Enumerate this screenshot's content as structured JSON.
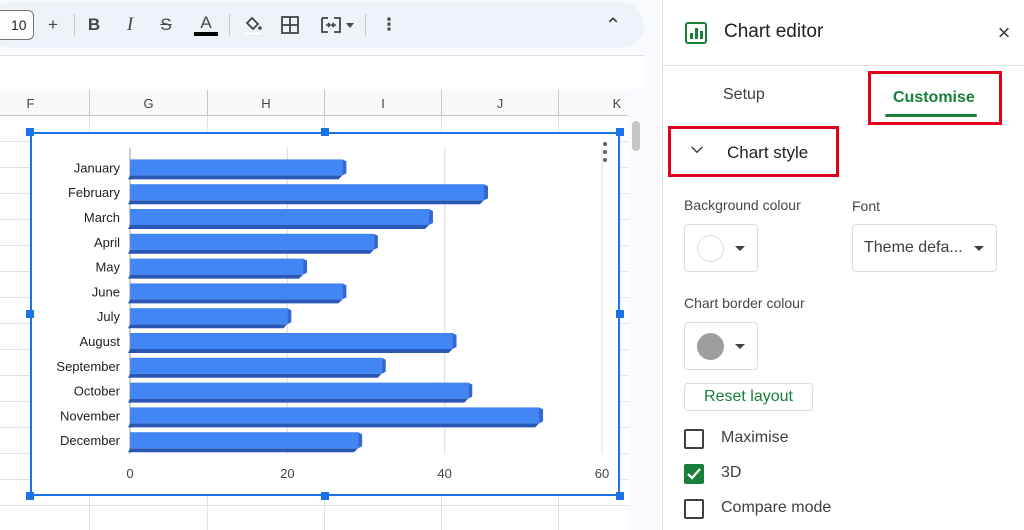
{
  "toolbar": {
    "font_size": "10",
    "plus_label": "+",
    "bold_label": "B",
    "italic_label": "I",
    "strike_label": "S",
    "text_color_label": "A",
    "more_label": "⋮",
    "collapse_label": "⌃"
  },
  "sheet": {
    "columns": [
      "F",
      "G",
      "H",
      "I",
      "J",
      "K"
    ]
  },
  "chart_data": {
    "type": "bar",
    "orientation": "horizontal",
    "three_d": true,
    "categories": [
      "January",
      "February",
      "March",
      "April",
      "May",
      "June",
      "July",
      "August",
      "September",
      "October",
      "November",
      "December"
    ],
    "values": [
      27,
      45,
      38,
      31,
      22,
      27,
      20,
      41,
      32,
      43,
      52,
      29
    ],
    "xlim": [
      0,
      60
    ],
    "xticks": [
      "0",
      "20",
      "40",
      "60"
    ],
    "bar_color": "#4285f4",
    "grid": true
  },
  "editor": {
    "title": "Chart editor",
    "close_label": "×",
    "tabs": [
      "Setup",
      "Customise"
    ],
    "active_tab": "Customise",
    "section_title": "Chart style",
    "background_colour_label": "Background colour",
    "background_colour": "#ffffff",
    "font_label": "Font",
    "font_value": "Theme defa...",
    "border_colour_label": "Chart border colour",
    "border_colour": "#9e9e9e",
    "reset_label": "Reset layout",
    "checkboxes": [
      {
        "label": "Maximise",
        "checked": false
      },
      {
        "label": "3D",
        "checked": true
      },
      {
        "label": "Compare mode",
        "checked": false
      }
    ],
    "accent_color": "#188038",
    "highlight_color": "#e0001b"
  }
}
